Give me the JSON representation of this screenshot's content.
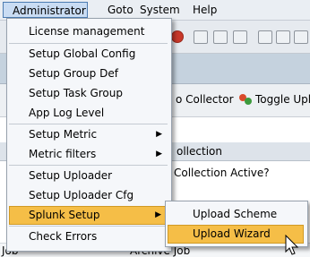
{
  "menubar": {
    "items": [
      {
        "label": "Administrator"
      },
      {
        "label": "Goto"
      },
      {
        "label": "System"
      },
      {
        "label": "Help"
      }
    ]
  },
  "app": {
    "collector_label": "o Collector",
    "toggle_label": "Toggle Uplo"
  },
  "grid": {
    "header_label": "ollection",
    "row_label": "Collection Active?",
    "last_row_left": "Job",
    "last_row_right": "Archive Job"
  },
  "menu": {
    "items": [
      {
        "label": "License management"
      },
      {
        "label": "Setup Global Config"
      },
      {
        "label": "Setup Group Def"
      },
      {
        "label": "Setup Task Group"
      },
      {
        "label": "App Log Level"
      },
      {
        "label": "Setup Metric",
        "submenu": true
      },
      {
        "label": "Metric filters",
        "submenu": true
      },
      {
        "label": "Setup Uploader"
      },
      {
        "label": "Setup Uploader Cfg"
      },
      {
        "label": "Splunk Setup",
        "submenu": true,
        "highlighted": true
      },
      {
        "label": "Check Errors"
      }
    ],
    "arrow_glyph": "▶"
  },
  "submenu": {
    "items": [
      {
        "label": "Upload Scheme"
      },
      {
        "label": "Upload Wizard",
        "highlighted": true
      }
    ]
  },
  "colors": {
    "highlight": "#f5be47",
    "menu_bg": "#f5f7fa"
  }
}
